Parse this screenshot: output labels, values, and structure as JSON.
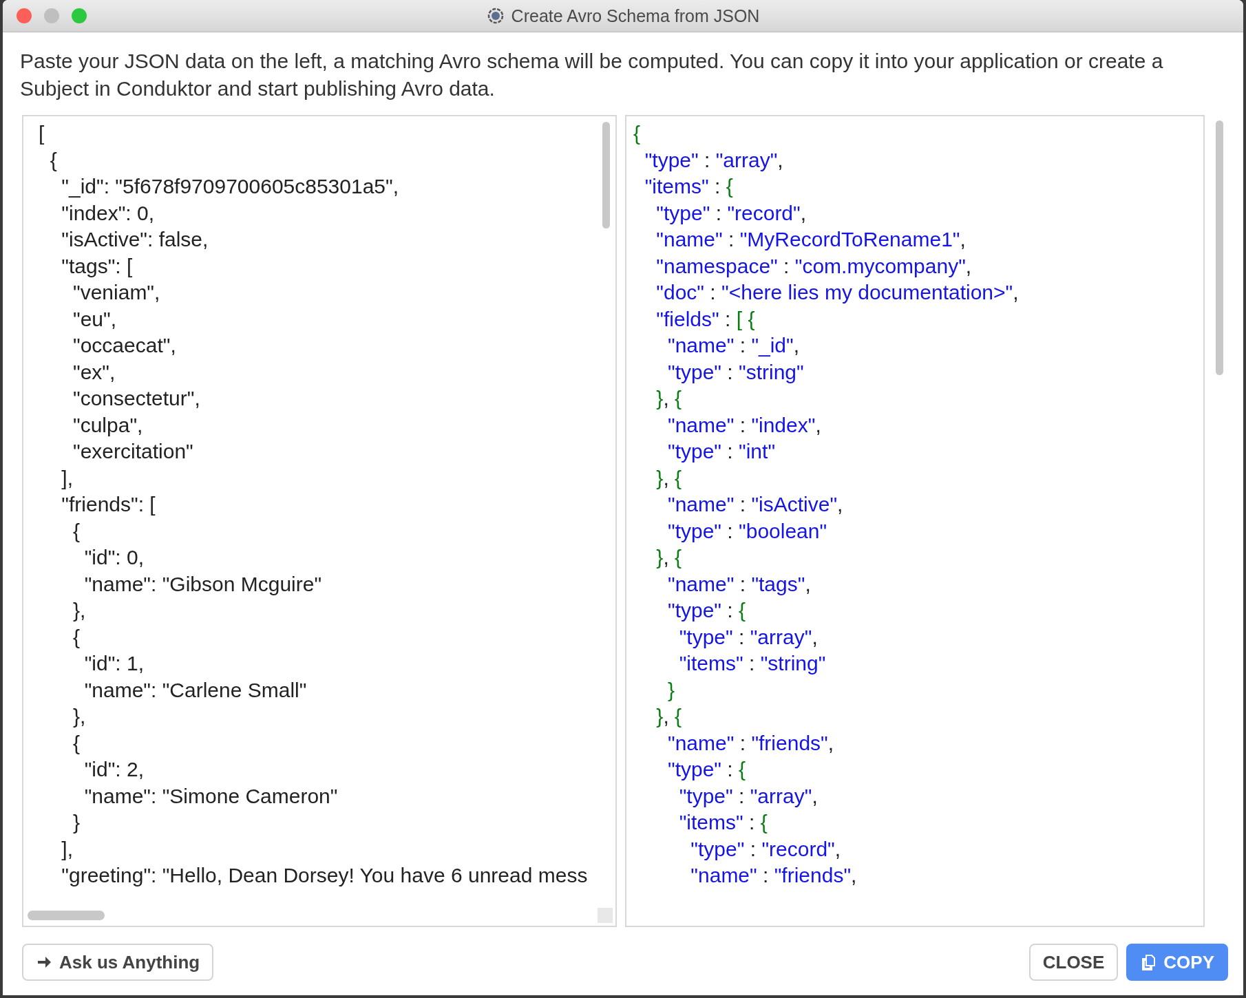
{
  "window": {
    "title": "Create Avro Schema from JSON"
  },
  "description": "Paste your JSON data on the left, a matching Avro schema will be computed. You can copy it into your application or create a Subject in Conduktor and start publishing Avro data.",
  "json_input": {
    "lines": [
      "[",
      "  {",
      "    \"_id\": \"5f678f9709700605c85301a5\",",
      "    \"index\": 0,",
      "    \"isActive\": false,",
      "    \"tags\": [",
      "      \"veniam\",",
      "      \"eu\",",
      "      \"occaecat\",",
      "      \"ex\",",
      "      \"consectetur\",",
      "      \"culpa\",",
      "      \"exercitation\"",
      "    ],",
      "    \"friends\": [",
      "      {",
      "        \"id\": 0,",
      "        \"name\": \"Gibson Mcguire\"",
      "      },",
      "      {",
      "        \"id\": 1,",
      "        \"name\": \"Carlene Small\"",
      "      },",
      "      {",
      "        \"id\": 2,",
      "        \"name\": \"Simone Cameron\"",
      "      }",
      "    ],",
      "    \"greeting\": \"Hello, Dean Dorsey! You have 6 unread mess"
    ]
  },
  "avro_schema": {
    "lines": [
      "{",
      "  \"type\" : \"array\",",
      "  \"items\" : {",
      "    \"type\" : \"record\",",
      "    \"name\" : \"MyRecordToRename1\",",
      "    \"namespace\" : \"com.mycompany\",",
      "    \"doc\" : \"<here lies my documentation>\",",
      "    \"fields\" : [ {",
      "      \"name\" : \"_id\",",
      "      \"type\" : \"string\"",
      "    }, {",
      "      \"name\" : \"index\",",
      "      \"type\" : \"int\"",
      "    }, {",
      "      \"name\" : \"isActive\",",
      "      \"type\" : \"boolean\"",
      "    }, {",
      "      \"name\" : \"tags\",",
      "      \"type\" : {",
      "        \"type\" : \"array\",",
      "        \"items\" : \"string\"",
      "      }",
      "    }, {",
      "      \"name\" : \"friends\",",
      "      \"type\" : {",
      "        \"type\" : \"array\",",
      "        \"items\" : {",
      "          \"type\" : \"record\",",
      "          \"name\" : \"friends\","
    ]
  },
  "buttons": [
    {
      "kind": "link",
      "label": "Ask us Anything"
    },
    {
      "kind": "secondary",
      "label": "CLOSE"
    },
    {
      "kind": "primary",
      "label": "COPY"
    }
  ]
}
